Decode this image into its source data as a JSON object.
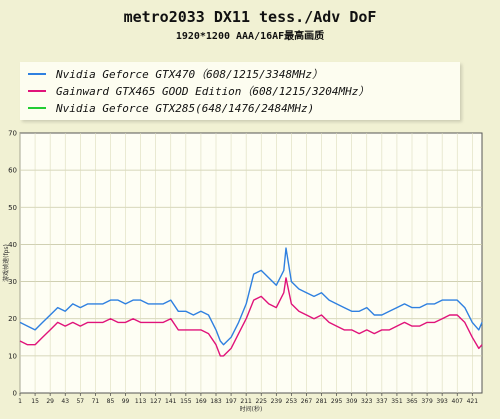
{
  "chart_data": {
    "type": "line",
    "title": "metro2033 DX11 tess./Adv DoF",
    "subtitle": "1920*1200 AAA/16AF最高画质",
    "xlabel": "时间(秒)",
    "ylabel": "游戏帧速(fps)",
    "ylim": [
      0,
      70
    ],
    "yticks": [
      0,
      10,
      20,
      30,
      40,
      50,
      60,
      70
    ],
    "xlim": [
      1,
      430
    ],
    "xticks": [
      1,
      15,
      29,
      43,
      57,
      71,
      85,
      99,
      113,
      127,
      141,
      155,
      169,
      183,
      197,
      211,
      225,
      239,
      253,
      267,
      281,
      295,
      309,
      323,
      337,
      351,
      365,
      379,
      393,
      407,
      421
    ],
    "grid": true,
    "legend_position": "top",
    "series": [
      {
        "name": "Nvidia Geforce GTX470（608/1215/3348MHz）",
        "color": "#2f80e0",
        "x": [
          1,
          8,
          15,
          22,
          29,
          36,
          43,
          50,
          57,
          64,
          71,
          78,
          85,
          92,
          99,
          106,
          113,
          120,
          127,
          134,
          141,
          148,
          155,
          162,
          169,
          176,
          183,
          187,
          190,
          197,
          204,
          211,
          218,
          225,
          232,
          239,
          246,
          248,
          253,
          260,
          267,
          274,
          281,
          288,
          295,
          302,
          309,
          316,
          323,
          330,
          337,
          344,
          351,
          358,
          365,
          372,
          379,
          386,
          393,
          400,
          407,
          414,
          421,
          427,
          430
        ],
        "values": [
          19,
          18,
          17,
          19,
          21,
          23,
          22,
          24,
          23,
          24,
          24,
          24,
          25,
          25,
          24,
          25,
          25,
          24,
          24,
          24,
          25,
          22,
          22,
          21,
          22,
          21,
          17,
          14,
          13,
          15,
          19,
          24,
          32,
          33,
          31,
          29,
          33,
          39,
          30,
          28,
          27,
          26,
          27,
          25,
          24,
          23,
          22,
          22,
          23,
          21,
          21,
          22,
          23,
          24,
          23,
          23,
          24,
          24,
          25,
          25,
          25,
          23,
          19,
          17,
          19
        ]
      },
      {
        "name": "Gainward GTX465 GOOD Edition（608/1215/3204MHz）",
        "color": "#e0137a",
        "x": [
          1,
          8,
          15,
          22,
          29,
          36,
          43,
          50,
          57,
          64,
          71,
          78,
          85,
          92,
          99,
          106,
          113,
          120,
          127,
          134,
          141,
          148,
          155,
          162,
          169,
          176,
          183,
          187,
          190,
          197,
          204,
          211,
          218,
          225,
          232,
          239,
          246,
          248,
          253,
          260,
          267,
          274,
          281,
          288,
          295,
          302,
          309,
          316,
          323,
          330,
          337,
          344,
          351,
          358,
          365,
          372,
          379,
          386,
          393,
          400,
          407,
          414,
          421,
          427,
          430
        ],
        "values": [
          14,
          13,
          13,
          15,
          17,
          19,
          18,
          19,
          18,
          19,
          19,
          19,
          20,
          19,
          19,
          20,
          19,
          19,
          19,
          19,
          20,
          17,
          17,
          17,
          17,
          16,
          13,
          10,
          10,
          12,
          16,
          20,
          25,
          26,
          24,
          23,
          27,
          31,
          24,
          22,
          21,
          20,
          21,
          19,
          18,
          17,
          17,
          16,
          17,
          16,
          17,
          17,
          18,
          19,
          18,
          18,
          19,
          19,
          20,
          21,
          21,
          19,
          15,
          12,
          13
        ]
      },
      {
        "name": "Nvidia Geforce GTX285(648/1476/2484MHz)",
        "color": "#22cc33",
        "x": [],
        "values": []
      }
    ]
  }
}
